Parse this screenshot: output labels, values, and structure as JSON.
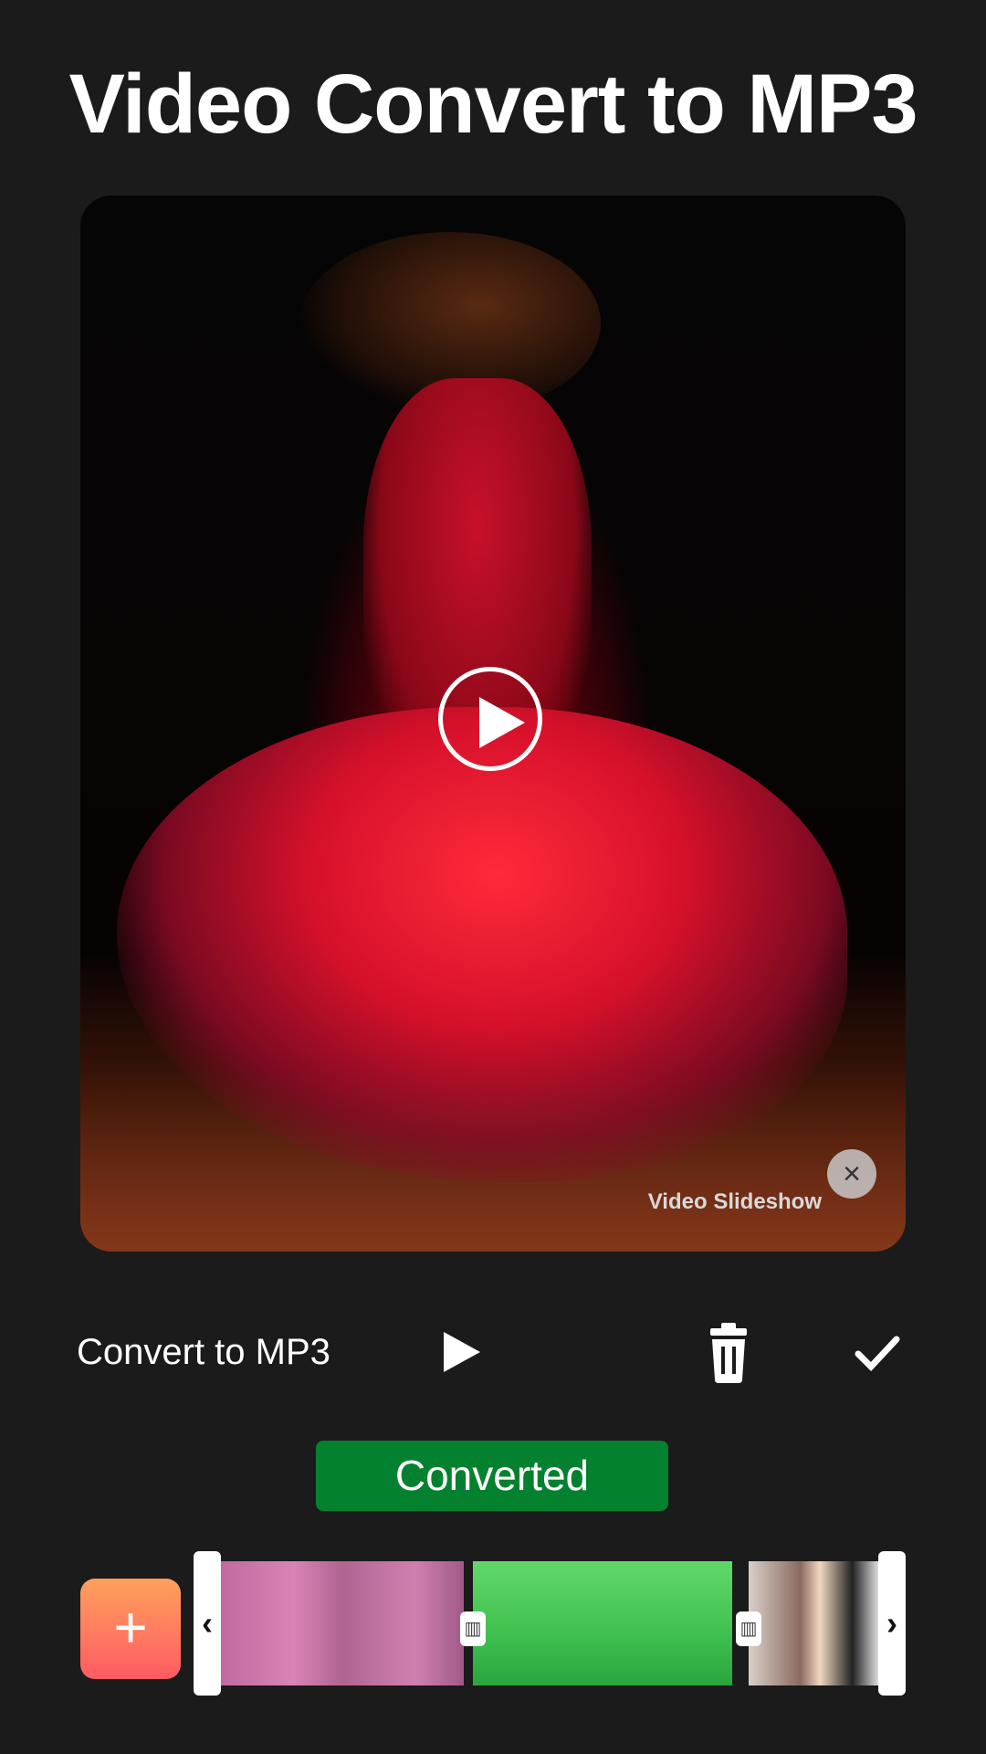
{
  "header": {
    "title": "Video Convert to MP3"
  },
  "preview": {
    "watermark": "Video Slideshow",
    "close_icon": "×"
  },
  "toolbar": {
    "label": "Convert to MP3"
  },
  "status": {
    "label": "Converted"
  },
  "timeline": {
    "add_icon": "+",
    "left_arrow": "‹",
    "right_arrow": "›",
    "splitter_icon": "▥",
    "clips": [
      "clip-1",
      "clip-2",
      "clip-3"
    ]
  },
  "colors": {
    "background": "#1b1b1b",
    "status_green": "#04812f",
    "add_gradient_top": "#ffa15c",
    "add_gradient_bottom": "#ff5b63"
  },
  "icons": [
    "play-icon",
    "trash-icon",
    "check-icon",
    "close-icon",
    "plus-icon",
    "chevron-left-icon",
    "chevron-right-icon",
    "split-icon"
  ]
}
